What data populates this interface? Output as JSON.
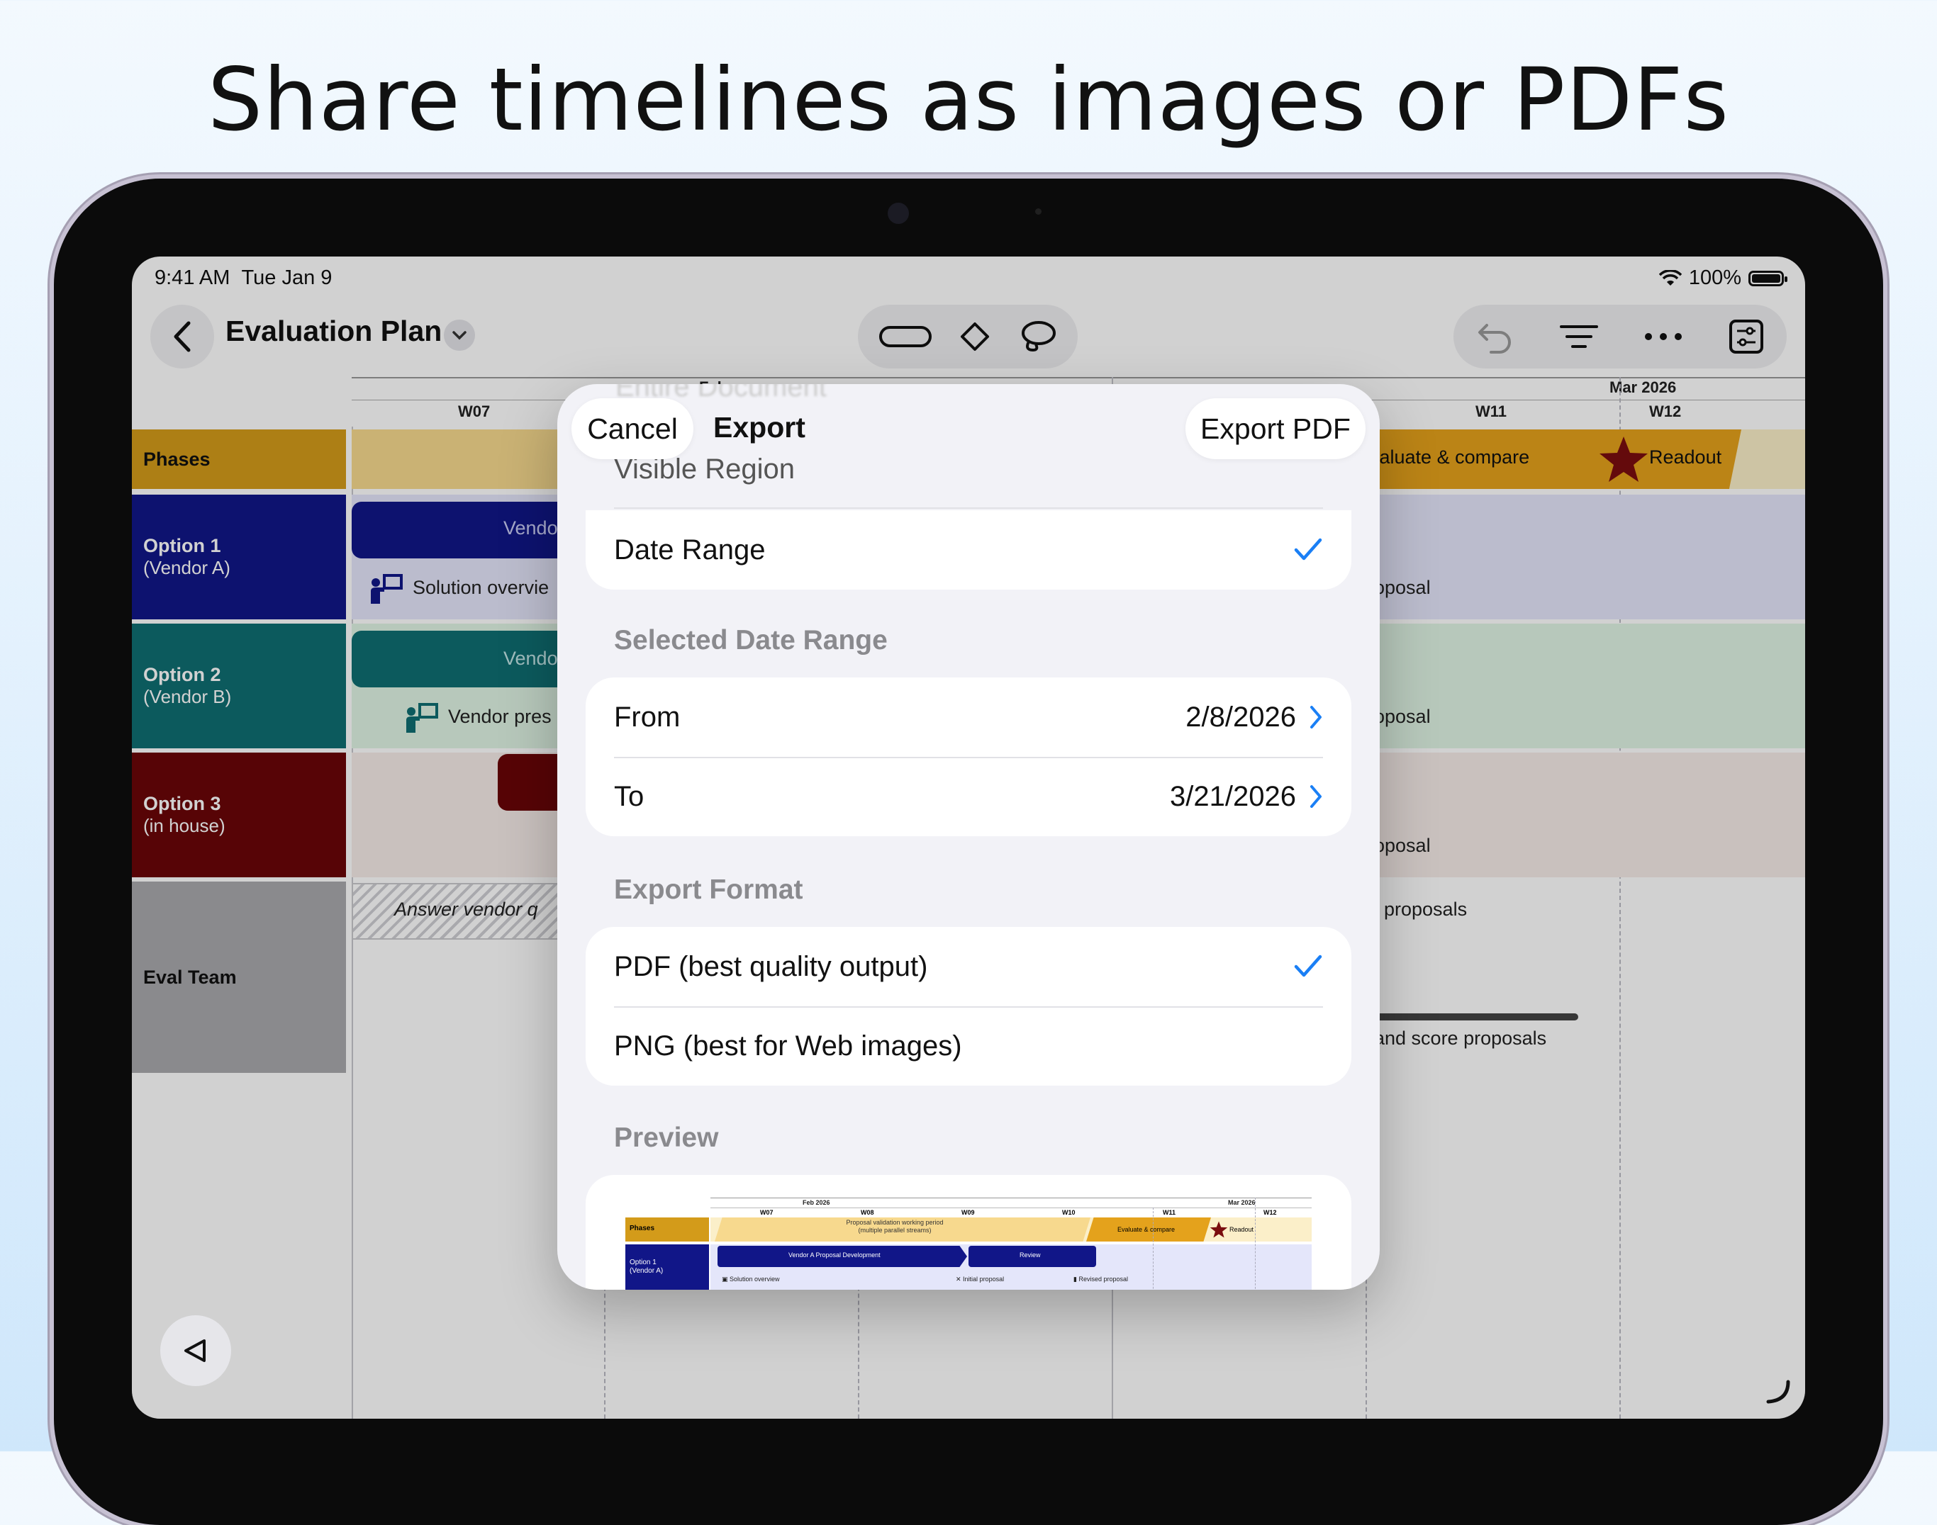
{
  "headline": "Share timelines as images or PDFs",
  "status": {
    "time": "9:41 AM",
    "date": "Tue Jan 9",
    "battery": "100%"
  },
  "toolbar": {
    "doc_title": "Evaluation Plan"
  },
  "timeline": {
    "months": [
      "Feb",
      "Mar 2026"
    ],
    "weeks": [
      "W07",
      "W11",
      "W12"
    ],
    "lanes": [
      {
        "title": "Phases",
        "subtitle": "",
        "color": "#d39b1a"
      },
      {
        "title": "Option 1",
        "subtitle": "(Vendor A)",
        "color": "#111688"
      },
      {
        "title": "Option 2",
        "subtitle": "(Vendor B)",
        "color": "#0f6e72"
      },
      {
        "title": "Option 3",
        "subtitle": "(in house)",
        "color": "#6b0508"
      },
      {
        "title": "Eval Team",
        "subtitle": "",
        "color": "#a9a9ad"
      }
    ],
    "items": {
      "evaluate": "valuate & compare",
      "readout": "Readout",
      "opt1_bar": "Vendo",
      "opt1_task": "Solution overvie",
      "opt1_right": "oposal",
      "opt2_bar": "Vendo",
      "opt2_task": "Vendor pres",
      "opt2_right": "oposal",
      "opt3_right": "oposal",
      "eval_left": "Answer vendor q",
      "eval_right1": "proposals",
      "eval_right2": "and score proposals"
    }
  },
  "sheet": {
    "ghost": "Entire Document",
    "cancel": "Cancel",
    "title": "Export",
    "action": "Export PDF",
    "visible_region": "Visible Region",
    "date_range": "Date Range",
    "selected_range_header": "Selected Date Range",
    "from_label": "From",
    "from_value": "2/8/2026",
    "to_label": "To",
    "to_value": "3/21/2026",
    "format_header": "Export Format",
    "format_pdf": "PDF (best quality output)",
    "format_png": "PNG (best for Web images)",
    "preview_header": "Preview"
  },
  "preview": {
    "month1": "Feb 2026",
    "month2": "Mar 2026",
    "weeks": [
      "W07",
      "W08",
      "W09",
      "W10",
      "W11",
      "W12"
    ],
    "phases": "Phases",
    "working": "Proposal validation working period",
    "working2": "(multiple parallel streams)",
    "evaluate": "Evaluate & compare",
    "readout": "Readout",
    "opt1": "Option 1",
    "opt1b": "(Vendor A)",
    "dev": "Vendor A Proposal Development",
    "review": "Review",
    "sol": "Solution overview",
    "initial": "Initial proposal",
    "revised": "Revised proposal"
  },
  "colors": {
    "accent": "#1a7ff5",
    "phases": "#d39b1a",
    "opt1": "#111688",
    "opt2": "#0f6e72",
    "opt3": "#6b0508",
    "star": "#7a0d0f"
  }
}
